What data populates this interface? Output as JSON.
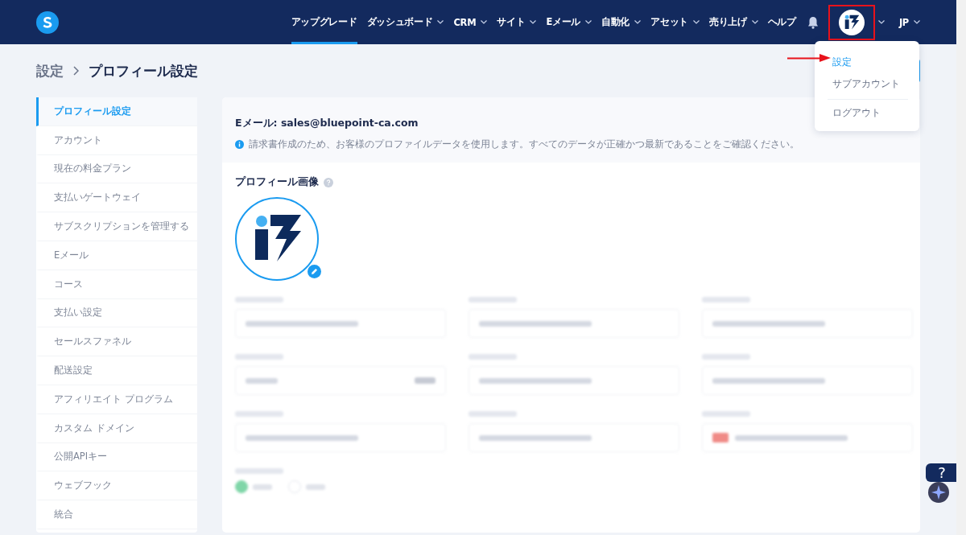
{
  "nav": {
    "items": [
      {
        "label": "アップグレード",
        "dropdown": false,
        "selected": true
      },
      {
        "label": "ダッシュボード",
        "dropdown": true,
        "selected": false
      },
      {
        "label": "CRM",
        "dropdown": true,
        "selected": false
      },
      {
        "label": "サイト",
        "dropdown": true,
        "selected": false
      },
      {
        "label": "Eメール",
        "dropdown": true,
        "selected": false
      },
      {
        "label": "自動化",
        "dropdown": true,
        "selected": false
      },
      {
        "label": "アセット",
        "dropdown": true,
        "selected": false
      },
      {
        "label": "売り上げ",
        "dropdown": true,
        "selected": false
      },
      {
        "label": "ヘルプ",
        "dropdown": false,
        "selected": false
      }
    ],
    "language": "JP",
    "avatar_highlighted": true
  },
  "user_menu": {
    "expanded": true,
    "items": [
      {
        "label": "設定",
        "selected": true,
        "separated": false
      },
      {
        "label": "サブアカウント",
        "selected": false,
        "separated": false
      },
      {
        "label": "ログアウト",
        "selected": false,
        "separated": true
      }
    ]
  },
  "breadcrumb": [
    "設定",
    "プロフィール設定"
  ],
  "sidebar": {
    "items": [
      {
        "label": "プロフィール設定",
        "selected": true
      },
      {
        "label": "アカウント",
        "selected": false
      },
      {
        "label": "現在の料金プラン",
        "selected": false
      },
      {
        "label": "支払いゲートウェイ",
        "selected": false
      },
      {
        "label": "サブスクリプションを管理する",
        "selected": false
      },
      {
        "label": "Eメール",
        "selected": false
      },
      {
        "label": "コース",
        "selected": false
      },
      {
        "label": "支払い設定",
        "selected": false
      },
      {
        "label": "セールスファネル",
        "selected": false
      },
      {
        "label": "配送設定",
        "selected": false
      },
      {
        "label": "アフィリエイト プログラム",
        "selected": false
      },
      {
        "label": "カスタム ドメイン",
        "selected": false
      },
      {
        "label": "公開APIキー",
        "selected": false
      },
      {
        "label": "ウェブフック",
        "selected": false
      },
      {
        "label": "統合",
        "selected": false
      }
    ]
  },
  "profile": {
    "email_label": "Eメール: sales@bluepoint-ca.com",
    "info": "請求書作成のため、お客様のプロファイルデータを使用します。すべてのデータが正確かつ最新であることをご確認ください。",
    "image_title": "プロフィール画像",
    "blurred_fields": [
      {
        "kind": "text"
      },
      {
        "kind": "text"
      },
      {
        "kind": "text"
      },
      {
        "kind": "select"
      },
      {
        "kind": "text"
      },
      {
        "kind": "text"
      },
      {
        "kind": "text"
      },
      {
        "kind": "text"
      },
      {
        "kind": "phone"
      }
    ],
    "blurred_radios": [
      {
        "selected": true
      },
      {
        "selected": false
      }
    ]
  },
  "help_widget": {
    "label": "?"
  }
}
